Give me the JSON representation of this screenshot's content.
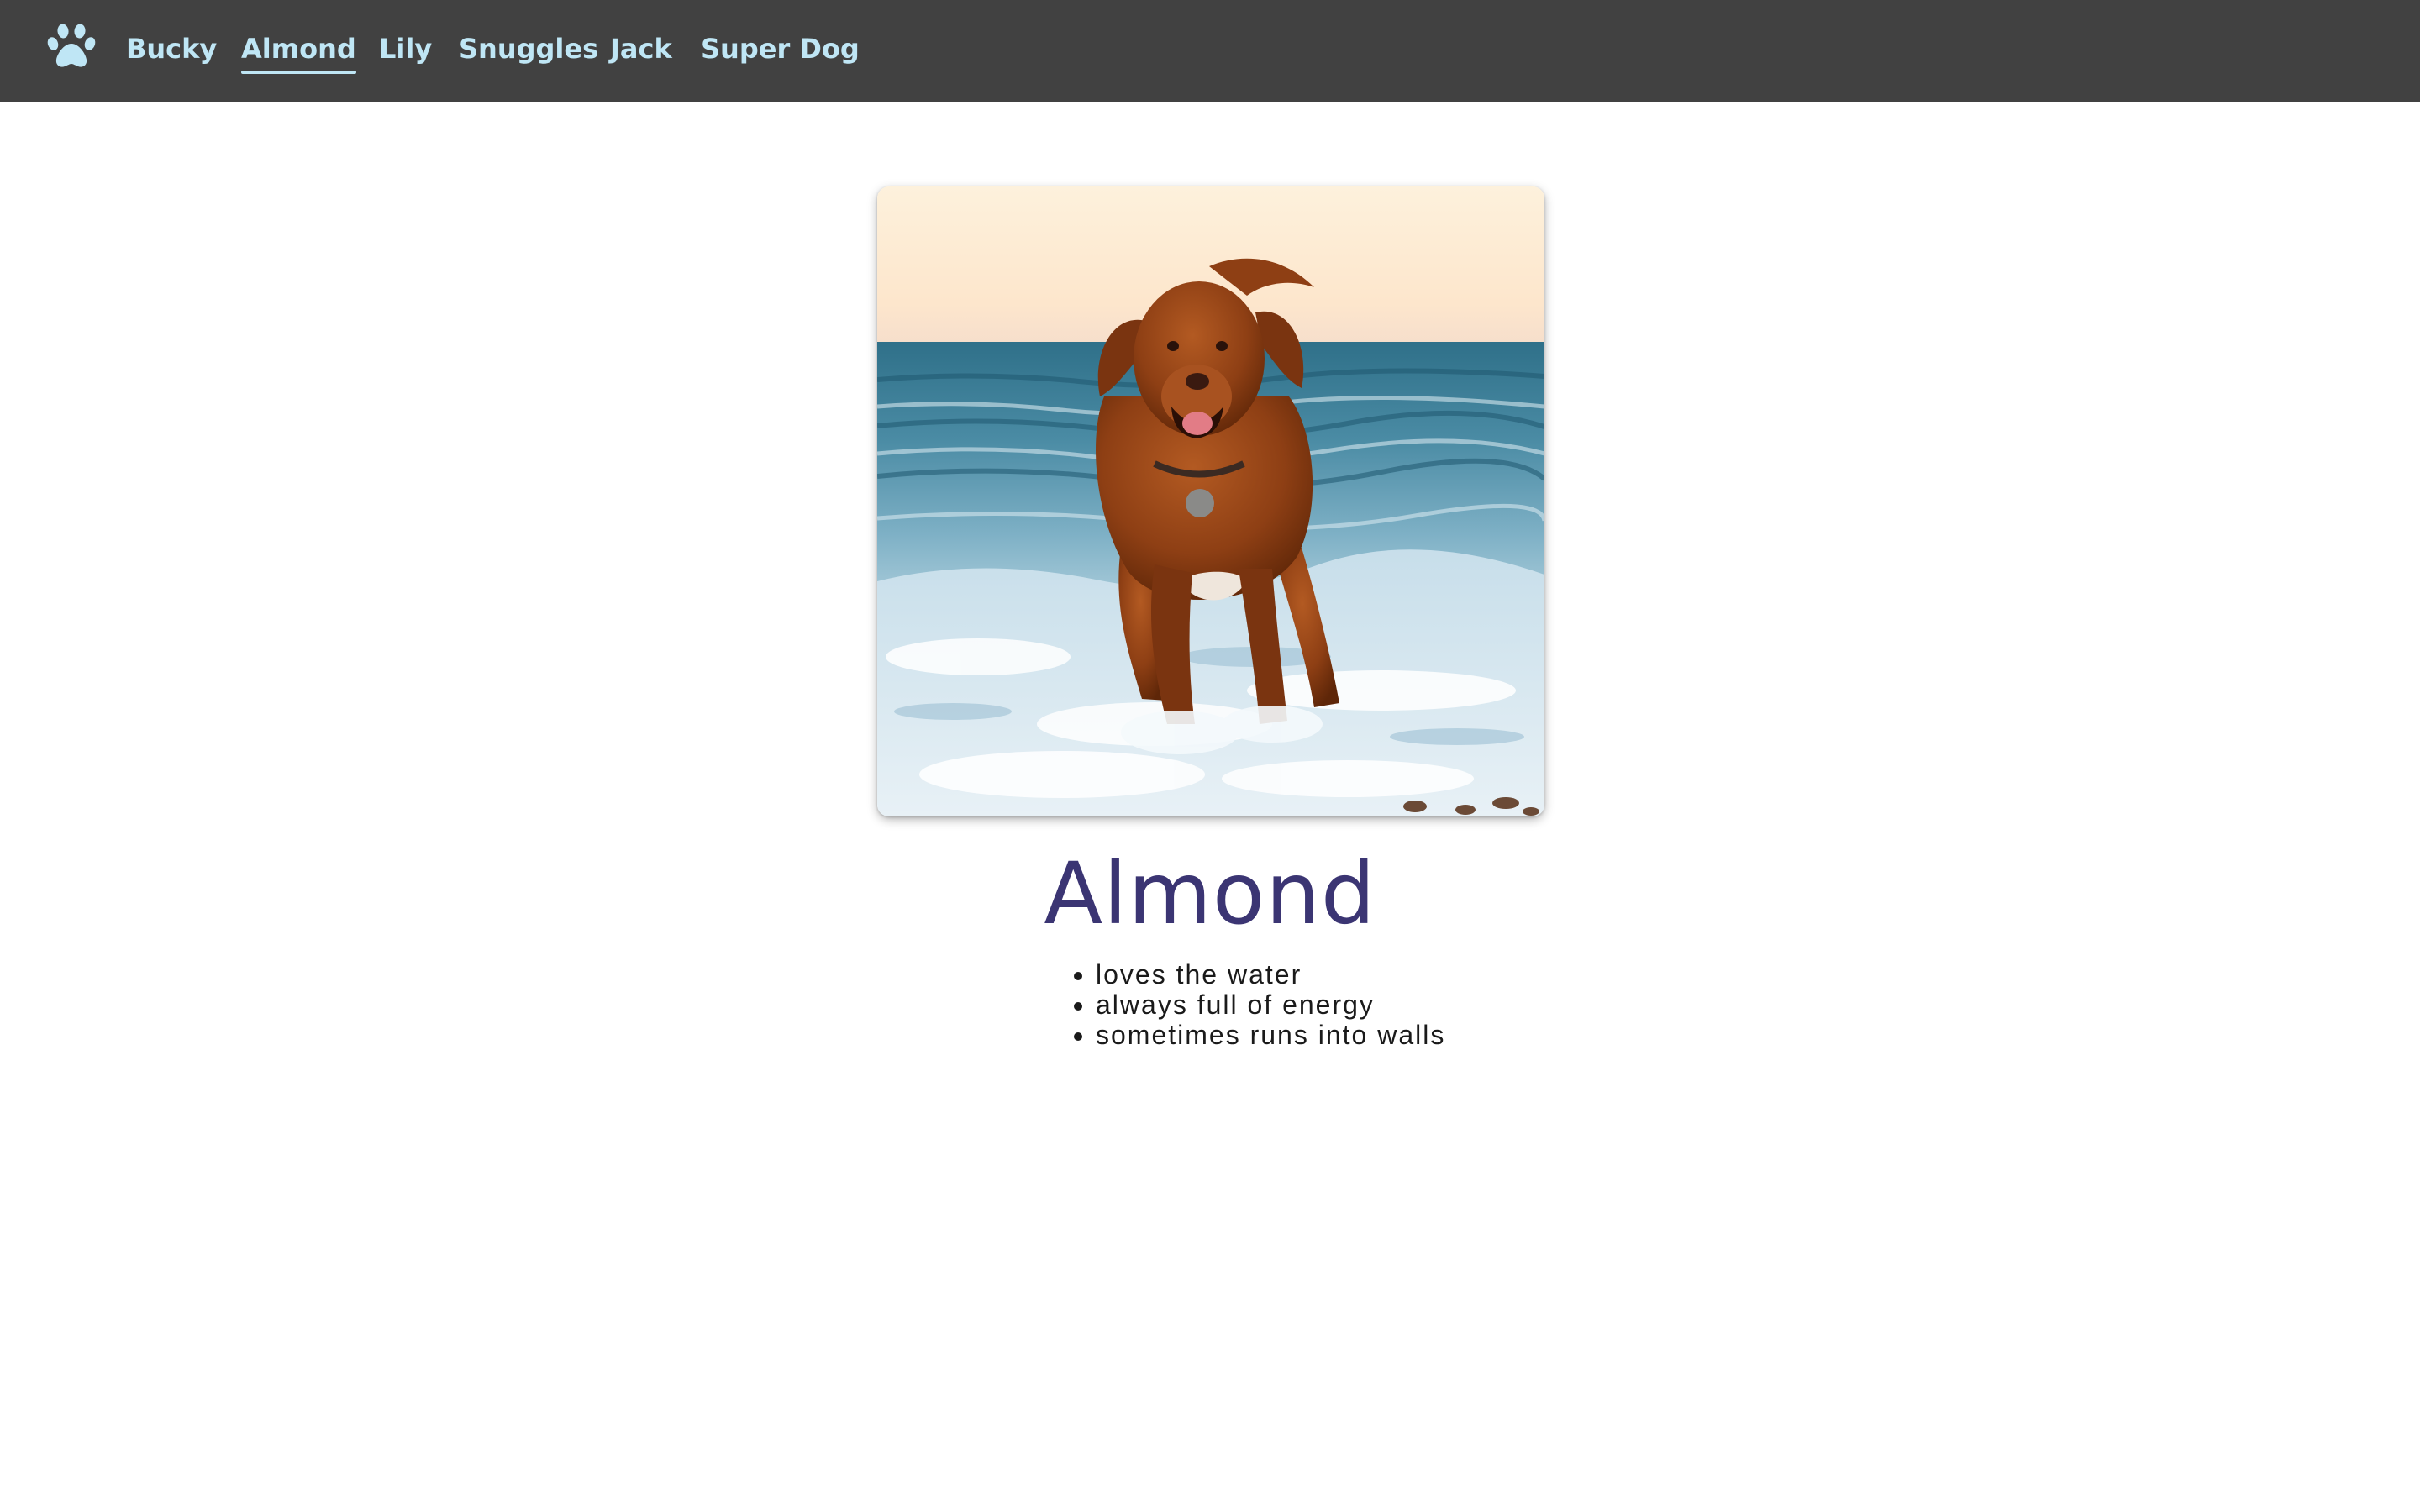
{
  "nav": {
    "logo_icon": "paw-icon",
    "accent_color": "#bfe6f5",
    "background_color": "#414141",
    "active_index": 1,
    "items": [
      {
        "label": "Bucky"
      },
      {
        "label": "Almond"
      },
      {
        "label": "Lily"
      },
      {
        "label": "Snuggles"
      },
      {
        "label": "Jack"
      },
      {
        "label": "Super Dog"
      }
    ]
  },
  "profile": {
    "photo_subject": "dog running out of the ocean surf",
    "name": "Almond",
    "name_color": "#3b3573",
    "traits": [
      "loves the water",
      "always full of energy",
      "sometimes runs into walls"
    ]
  }
}
